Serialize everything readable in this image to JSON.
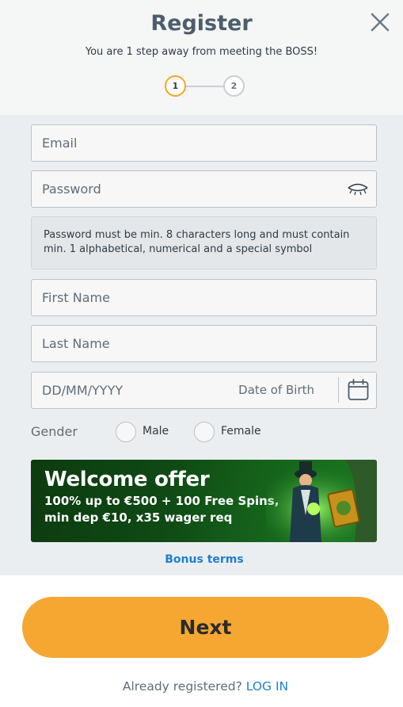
{
  "header": {
    "title": "Register",
    "subtitle": "You are 1 step away from meeting the BOSS!",
    "steps": [
      {
        "label": "1",
        "active": true
      },
      {
        "label": "2",
        "active": false
      }
    ],
    "close_icon": "close-icon"
  },
  "form": {
    "email_placeholder": "Email",
    "password_placeholder": "Password",
    "password_hint": "Password must be min. 8 characters long and must contain min. 1 alphabetical, numerical and a special symbol",
    "first_name_placeholder": "First Name",
    "last_name_placeholder": "Last Name",
    "dob_placeholder": "DD/MM/YYYY",
    "dob_label": "Date of Birth",
    "gender_label": "Gender",
    "gender_options": [
      "Male",
      "Female"
    ],
    "icons": {
      "password_toggle": "eye-closed-icon",
      "dob_picker": "calendar-icon"
    }
  },
  "banner": {
    "title": "Welcome offer",
    "text": "100% up to €500 + 100 Free Spins, min dep €10, x35 wager req"
  },
  "bonus_terms_label": "Bonus terms",
  "next_label": "Next",
  "footer": {
    "prompt": "Already registered?",
    "login_label": "LOG IN"
  },
  "colors": {
    "accent": "#f5a732",
    "link": "#1f7fcf",
    "step_active": "#f5a623",
    "banner_green": "#0f4a14"
  }
}
